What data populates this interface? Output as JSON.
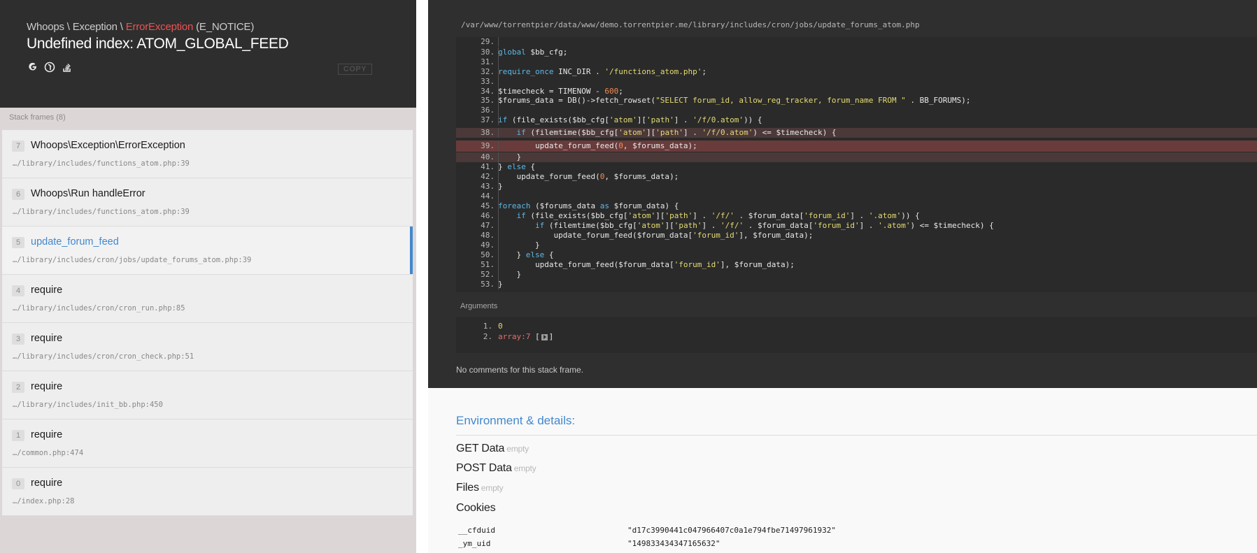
{
  "header": {
    "exception_prefix": "Whoops \\ Exception \\ ",
    "exception_class": "ErrorException",
    "exception_code": " (E_NOTICE)",
    "message": "Undefined index: ATOM_GLOBAL_FEED",
    "copy_label": "COPY",
    "search_icons": [
      "google-search-icon",
      "duckduckgo-search-icon",
      "stackoverflow-search-icon"
    ]
  },
  "frames_label": "Stack frames (8)",
  "frames": [
    {
      "index": "7",
      "name": "Whoops\\Exception\\ErrorException",
      "file": "…/library/includes/functions_atom.php:39"
    },
    {
      "index": "6",
      "name": "Whoops\\Run handleError",
      "file": "…/library/includes/functions_atom.php:39"
    },
    {
      "index": "5",
      "name": "update_forum_feed",
      "file": "…/library/includes/cron/jobs/update_forums_atom.php:39"
    },
    {
      "index": "4",
      "name": "require",
      "file": "…/library/includes/cron/cron_run.php:85"
    },
    {
      "index": "3",
      "name": "require",
      "file": "…/library/includes/cron/cron_check.php:51"
    },
    {
      "index": "2",
      "name": "require",
      "file": "…/library/includes/init_bb.php:450"
    },
    {
      "index": "1",
      "name": "require",
      "file": "…/common.php:474"
    },
    {
      "index": "0",
      "name": "require",
      "file": "…/index.php:28"
    }
  ],
  "code_view": {
    "file_path": "/var/www/torrentpier/data/www/demo.torrentpier.me/library/includes/cron/jobs/update_forums_atom.php",
    "lines": [
      {
        "n": "29.",
        "src": ""
      },
      {
        "n": "30.",
        "src": "global $bb_cfg;"
      },
      {
        "n": "31.",
        "src": ""
      },
      {
        "n": "32.",
        "src": "require_once INC_DIR . '/functions_atom.php';"
      },
      {
        "n": "33.",
        "src": ""
      },
      {
        "n": "34.",
        "src": "$timecheck = TIMENOW - 600;"
      },
      {
        "n": "35.",
        "src": "$forums_data = DB()->fetch_rowset(\"SELECT forum_id, allow_reg_tracker, forum_name FROM \" . BB_FORUMS);"
      },
      {
        "n": "36.",
        "src": ""
      },
      {
        "n": "37.",
        "src": "if (file_exists($bb_cfg['atom']['path'] . '/f/0.atom')) {"
      },
      {
        "n": "38.",
        "src": "    if (filemtime($bb_cfg['atom']['path'] . '/f/0.atom') <= $timecheck) {"
      },
      {
        "n": "39.",
        "src": "        update_forum_feed(0, $forums_data);"
      },
      {
        "n": "40.",
        "src": "    }"
      },
      {
        "n": "41.",
        "src": "} else {"
      },
      {
        "n": "42.",
        "src": "    update_forum_feed(0, $forums_data);"
      },
      {
        "n": "43.",
        "src": "}"
      },
      {
        "n": "44.",
        "src": ""
      },
      {
        "n": "45.",
        "src": "foreach ($forums_data as $forum_data) {"
      },
      {
        "n": "46.",
        "src": "    if (file_exists($bb_cfg['atom']['path'] . '/f/' . $forum_data['forum_id'] . '.atom')) {"
      },
      {
        "n": "47.",
        "src": "        if (filemtime($bb_cfg['atom']['path'] . '/f/' . $forum_data['forum_id'] . '.atom') <= $timecheck) {"
      },
      {
        "n": "48.",
        "src": "            update_forum_feed($forum_data['forum_id'], $forum_data);"
      },
      {
        "n": "49.",
        "src": "        }"
      },
      {
        "n": "50.",
        "src": "    } else {"
      },
      {
        "n": "51.",
        "src": "        update_forum_feed($forum_data['forum_id'], $forum_data);"
      },
      {
        "n": "52.",
        "src": "    }"
      },
      {
        "n": "53.",
        "src": "}"
      }
    ]
  },
  "arguments": {
    "label": "Arguments",
    "items": [
      {
        "n": "1.",
        "value": "0"
      },
      {
        "n": "2.",
        "value": "array:7",
        "open": "[",
        "close": "]"
      }
    ]
  },
  "no_comments": "No comments for this stack frame.",
  "environment": {
    "title": "Environment & details:",
    "sections": [
      {
        "name": "GET Data",
        "state": "empty"
      },
      {
        "name": "POST Data",
        "state": "empty"
      },
      {
        "name": "Files",
        "state": "empty"
      },
      {
        "name": "Cookies",
        "state": ""
      }
    ],
    "cookies": [
      {
        "key": "__cfduid",
        "value": "\"d17c3990441c047966407c0a1e794fbe71497961932\""
      },
      {
        "key": "_ym_uid",
        "value": "\"149833434347165632\""
      }
    ]
  },
  "colors": {
    "accent": "#4288ce",
    "exception_red": "#e95353",
    "code_bg": "#2a2a2a",
    "highlight_line": "#6a3b3b"
  }
}
